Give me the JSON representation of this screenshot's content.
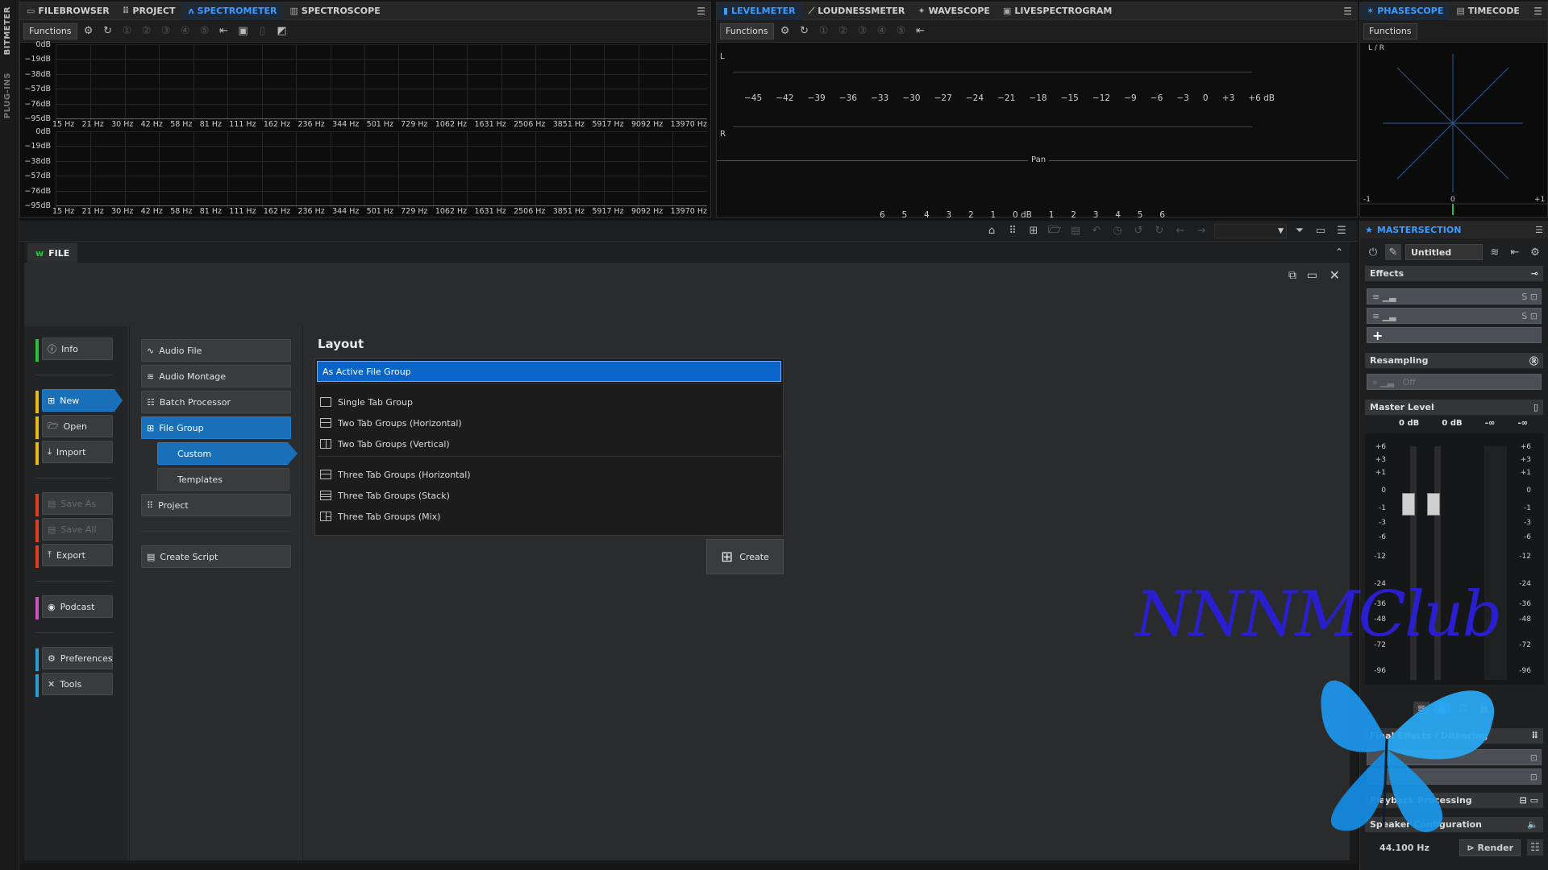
{
  "left_strip": {
    "bitmeter": "BITMETER",
    "plugins": "PLUG-INS"
  },
  "spectro_panel": {
    "tabs": [
      {
        "label": "FILEBROWSER",
        "icon": "file-browser-icon"
      },
      {
        "label": "PROJECT",
        "icon": "project-icon"
      },
      {
        "label": "SPECTROMETER",
        "icon": "spectrometer-icon",
        "active": true
      },
      {
        "label": "SPECTROSCOPE",
        "icon": "spectroscope-icon"
      }
    ],
    "functions_label": "Functions",
    "db_labels": [
      "0dB",
      "−19dB",
      "−38dB",
      "−57dB",
      "−76dB",
      "−95dB"
    ],
    "hz_labels": [
      "15 Hz",
      "21 Hz",
      "30 Hz",
      "42 Hz",
      "58 Hz",
      "81 Hz",
      "111 Hz",
      "162 Hz",
      "236 Hz",
      "344 Hz",
      "501 Hz",
      "729 Hz",
      "1062 Hz",
      "1631 Hz",
      "2506 Hz",
      "3851 Hz",
      "5917 Hz",
      "9092 Hz",
      "13970 Hz"
    ]
  },
  "level_panel": {
    "tabs": [
      {
        "label": "LEVELMETER",
        "icon": "levelmeter-icon",
        "active": true
      },
      {
        "label": "LOUDNESSMETER",
        "icon": "loudness-icon"
      },
      {
        "label": "WAVESCOPE",
        "icon": "wavescope-icon"
      },
      {
        "label": "LIVESPECTROGRAM",
        "icon": "livespectrogram-icon"
      }
    ],
    "functions_label": "Functions",
    "channel_l": "L",
    "channel_r": "R",
    "db_scale": [
      "−45",
      "−42",
      "−39",
      "−36",
      "−33",
      "−30",
      "−27",
      "−24",
      "−21",
      "−18",
      "−15",
      "−12",
      "−9",
      "−6",
      "−3",
      "0",
      "+3",
      "+6 dB"
    ],
    "pan_label": "Pan",
    "pan_scale": [
      "6",
      "5",
      "4",
      "3",
      "2",
      "1",
      "0 dB",
      "1",
      "2",
      "3",
      "4",
      "5",
      "6"
    ]
  },
  "phase_panel": {
    "tabs": [
      {
        "label": "PHASESCOPE",
        "icon": "phasescope-icon",
        "active": true
      },
      {
        "label": "TIMECODE",
        "icon": "timecode-icon"
      }
    ],
    "functions_label": "Functions",
    "lr_label": "L / R",
    "axis": [
      "-1",
      "0",
      "+1"
    ]
  },
  "file_window": {
    "tab_label": "FILE",
    "left_nav": [
      {
        "label": "Info",
        "icon": "info-icon",
        "color": "#2bc23b"
      },
      {
        "label": "New",
        "icon": "new-file-icon",
        "color": "#e8b818",
        "selected": true
      },
      {
        "label": "Open",
        "icon": "open-folder-icon",
        "color": "#e8b818"
      },
      {
        "label": "Import",
        "icon": "import-icon",
        "color": "#e8b818"
      },
      {
        "label": "Save As",
        "icon": "save-as-icon",
        "color": "#e04020",
        "disabled": true
      },
      {
        "label": "Save All",
        "icon": "save-all-icon",
        "color": "#e04020",
        "disabled": true
      },
      {
        "label": "Export",
        "icon": "export-icon",
        "color": "#e04020"
      },
      {
        "label": "Podcast",
        "icon": "podcast-icon",
        "color": "#d050c8"
      },
      {
        "label": "Preferences",
        "icon": "gear-icon",
        "color": "#2aa0d8"
      },
      {
        "label": "Tools",
        "icon": "tools-icon",
        "color": "#2aa0d8"
      }
    ],
    "mid_nav": [
      {
        "label": "Audio File",
        "icon": "audio-file-icon"
      },
      {
        "label": "Audio Montage",
        "icon": "audio-montage-icon"
      },
      {
        "label": "Batch Processor",
        "icon": "batch-processor-icon"
      },
      {
        "label": "File Group",
        "icon": "file-group-icon",
        "selected": true
      },
      {
        "label": "Custom",
        "sub": true,
        "selected": true
      },
      {
        "label": "Templates",
        "sub": true
      },
      {
        "label": "Project",
        "icon": "project-grid-icon"
      },
      {
        "label": "Create Script",
        "icon": "script-icon"
      }
    ],
    "layout_title": "Layout",
    "layout_options": [
      "As Active File Group",
      "Single Tab Group",
      "Two Tab Groups (Horizontal)",
      "Two Tab Groups (Vertical)",
      "Three Tab Groups (Horizontal)",
      "Three Tab Groups (Stack)",
      "Three Tab Groups (Mix)"
    ],
    "create_label": "Create"
  },
  "master": {
    "title": "MASTERSECTION",
    "preset": "Untitled",
    "effects": "Effects",
    "resampling": "Resampling",
    "resampling_value": "Off",
    "master_level": "Master Level",
    "level_values": [
      "0 dB",
      "0 dB",
      "-∞",
      "-∞"
    ],
    "scale": [
      "+6",
      "+3",
      "+1",
      "0",
      "-1",
      "-3",
      "-6",
      "-12",
      "-24",
      "-36",
      "-48",
      "-72",
      "-96"
    ],
    "final_effects": "Final Effects / Dithering",
    "playback": "Playback Processing",
    "speaker": "Speaker Configuration",
    "sample_rate": "44.100 Hz",
    "render": "Render"
  },
  "watermark": "NNNMClub"
}
